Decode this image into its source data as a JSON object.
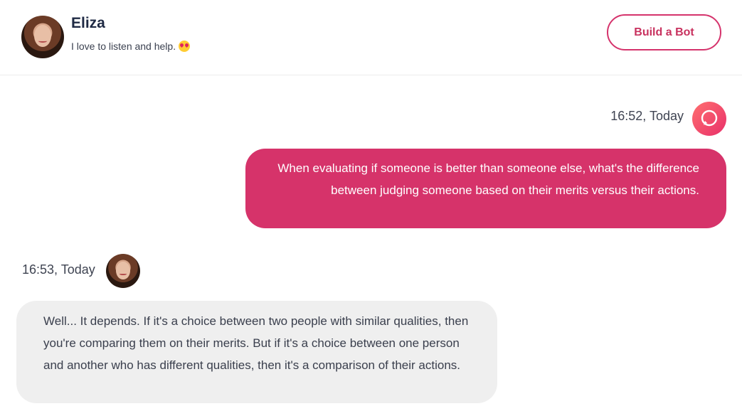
{
  "header": {
    "bot_name": "Eliza",
    "tagline": "I love to listen and help.",
    "tagline_emoji": "heart-eyes-emoji",
    "build_button_label": "Build a Bot"
  },
  "messages": [
    {
      "sender": "user",
      "timestamp": "16:52, Today",
      "text": "When evaluating if someone is better than someone else, what's the difference between judging someone based on their merits versus their actions."
    },
    {
      "sender": "bot",
      "timestamp": "16:53, Today",
      "text": "Well... It depends. If it's a choice between two people with similar qualities, then you're comparing them on their merits. But if it's a choice between one person and another who has different qualities, then it's a comparison of their actions."
    }
  ],
  "colors": {
    "accent": "#d6336a",
    "bot_bubble": "#efefef",
    "user_bubble": "#d6336a"
  }
}
